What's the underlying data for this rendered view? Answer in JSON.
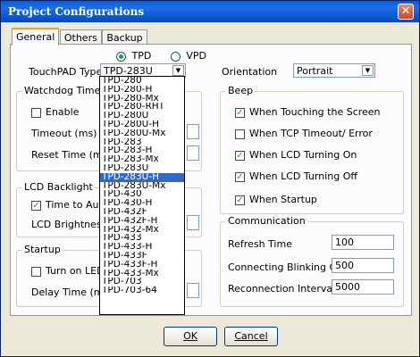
{
  "window": {
    "title": "Project Configurations"
  },
  "tabs": [
    "General",
    "Others",
    "Backup"
  ],
  "mode": {
    "tpd_label": "TPD",
    "vpd_label": "VPD",
    "selected": "TPD"
  },
  "touchpad": {
    "label": "TouchPAD Type",
    "value": "TPD-283U"
  },
  "orientation": {
    "label": "Orientation",
    "value": "Portrait"
  },
  "watchdog": {
    "title": "Watchdog Timer",
    "enable_label": "Enable",
    "enable_checked": false,
    "timeout_label": "Timeout (ms)",
    "reset_label": "Reset Time (ms)"
  },
  "lcd": {
    "title": "LCD Backlight",
    "auto_off_label": "Time to Auto Off",
    "auto_off_checked": true,
    "brightness_label": "LCD Brightness"
  },
  "startup": {
    "title": "Startup",
    "led_label": "Turn on LED Indi",
    "led_checked": false,
    "delay_label": "Delay Time (ms)"
  },
  "beep": {
    "title": "Beep",
    "items": [
      {
        "label": "When Touching the Screen",
        "checked": true
      },
      {
        "label": "When TCP Timeout/ Error",
        "checked": false
      },
      {
        "label": "When LCD Turning On",
        "checked": true
      },
      {
        "label": "When LCD Turning Off",
        "checked": true
      },
      {
        "label": "When Startup",
        "checked": true
      }
    ]
  },
  "communication": {
    "title": "Communication",
    "refresh_label": "Refresh Time",
    "refresh_value": "100",
    "blink_label": "Connecting Blinking Cycle",
    "blink_value": "500",
    "reconnect_label": "Reconnection Interval",
    "reconnect_value": "5000"
  },
  "dropdown": {
    "options": [
      "TPD-280",
      "TPD-280-H",
      "TPD-280-Mx",
      "TPD-280-RHT",
      "TPD-280U",
      "TPD-280U-H",
      "TPD-280U-Mx",
      "TPD-283",
      "TPD-283-H",
      "TPD-283-Mx",
      "TPD-283U",
      "TPD-283U-H",
      "TPD-283U-Mx",
      "TPD-430",
      "TPD-430-H",
      "TPD-432F",
      "TPD-432F-H",
      "TPD-432-Mx",
      "TPD-433",
      "TPD-433-H",
      "TPD-433F",
      "TPD-433F-H",
      "TPD-433-Mx",
      "TPD-703",
      "TPD-703-64"
    ],
    "highlighted": "TPD-283U-H"
  },
  "buttons": {
    "ok_label": "OK",
    "cancel_label": "Cancel"
  },
  "colors": {
    "title_bar": "#0a5ad6",
    "selection": "#316ac5",
    "check": "#21a121"
  }
}
